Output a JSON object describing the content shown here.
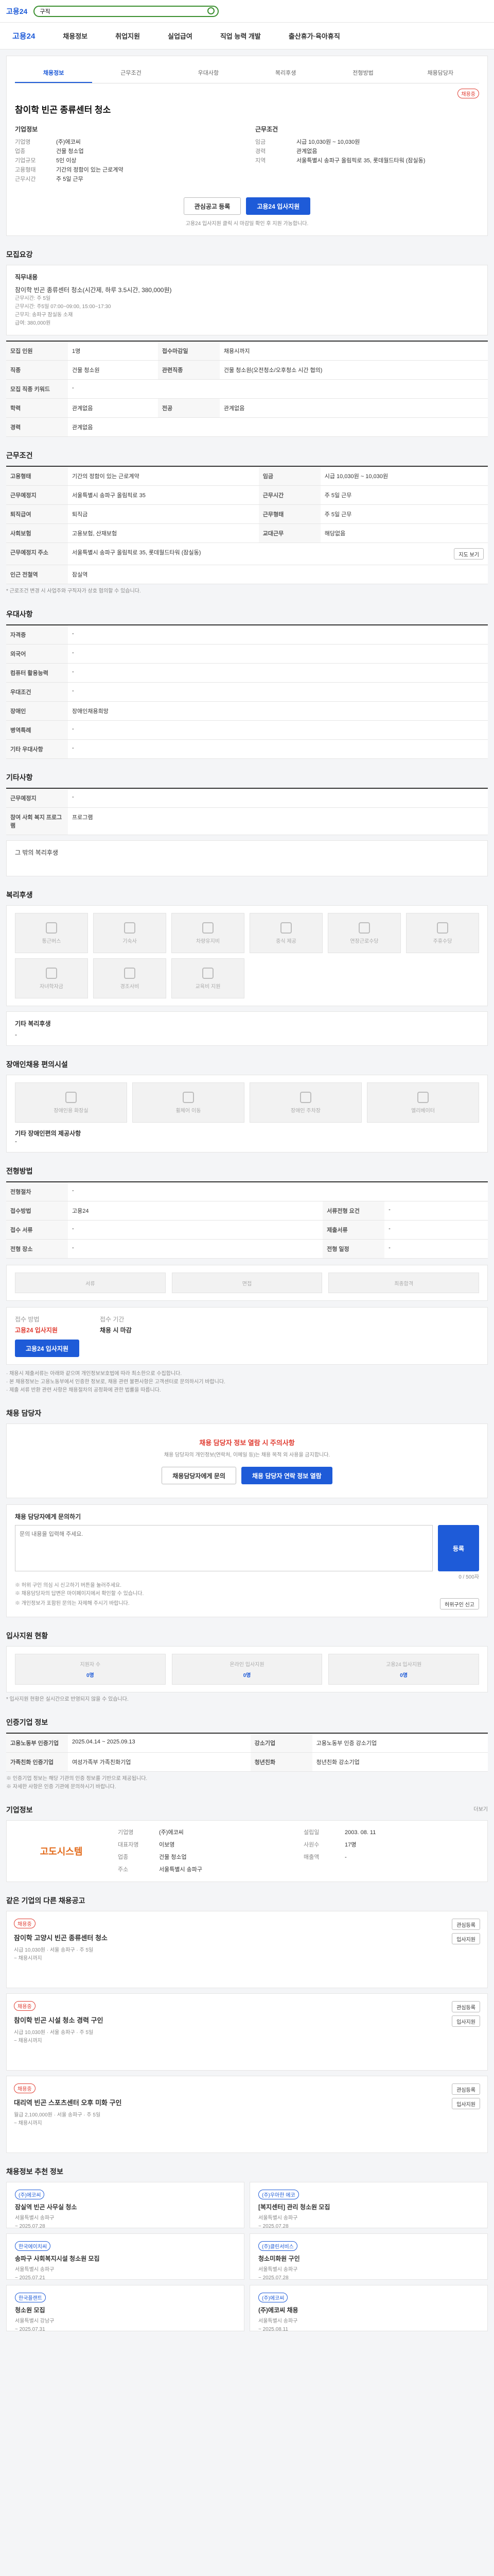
{
  "header": {
    "logo": "고용24",
    "search_value": "구직",
    "gnb": [
      "채용정보",
      "취업지원",
      "실업급여",
      "직업 능력 개발",
      "출산휴가·육아휴직"
    ]
  },
  "breadcrumb_tabs": [
    "채용정보",
    "근무조건",
    "우대사항",
    "복리후생",
    "전형방법",
    "채용담당자"
  ],
  "job": {
    "status": "채용중",
    "title": "참이학 빈곤 종류센터 청소",
    "company_label": "기업정보",
    "company_rows": [
      {
        "k": "기업명",
        "v": "(주)에코씨"
      },
      {
        "k": "업종",
        "v": "건물 청소업"
      },
      {
        "k": "기업규모",
        "v": "5인 이상"
      },
      {
        "k": "고용형태",
        "v": "기간의 정함이 있는 근로계약"
      },
      {
        "k": "근무시간",
        "v": "주 5일 근무"
      }
    ],
    "work_label": "근무조건",
    "work_rows": [
      {
        "k": "임금",
        "v": "시급 10,030원 ~ 10,030원"
      },
      {
        "k": "경력",
        "v": "관계없음"
      },
      {
        "k": "지역",
        "v": "서울특별시 송파구 올림픽로 35, 롯데월드타워 (잠실동)"
      }
    ],
    "btn_scrap": "관심공고 등록",
    "btn_apply": "고용24 입사지원",
    "deadline_note": "고용24 입사지원 클릭 시 마감일 확인 후 지원 가능합니다."
  },
  "recruit": {
    "title": "모집요강",
    "duty_label": "직무내용",
    "duty_text": "참이학 빈곤 종류센터 청소(시간제, 하루 3.5시간, 380,000원)",
    "duty_lines": [
      "근무시간: 주 5일",
      "근무시간: 주5일 07:00~09:00, 15:00~17:30",
      "근무지: 송파구 잠실동 소재",
      "급여: 380,000원"
    ],
    "rows": [
      {
        "k": "모집 인원",
        "v": "1명",
        "k2": "접수마감일",
        "v2": "채용시까지"
      },
      {
        "k": "직종",
        "v": "건물 청소원",
        "k2": "관련직종",
        "v2": "건물 청소원(오전청소/오후청소 시간 협의)"
      },
      {
        "k": "모집 직종 키워드",
        "v": "-",
        "k2": "",
        "v2": ""
      },
      {
        "k": "학력",
        "v": "관계없음",
        "k2": "전공",
        "v2": "관계없음"
      },
      {
        "k": "경력",
        "v": "관계없음",
        "k2": "",
        "v2": ""
      }
    ]
  },
  "condition": {
    "title": "근무조건",
    "rows": [
      {
        "k": "고용형태",
        "v": "기간의 정함이 있는 근로계약",
        "k2": "임금",
        "v2": "시급 10,030원 ~ 10,030원"
      },
      {
        "k": "근무예정지",
        "v": "서울특별시 송파구 올림픽로 35",
        "k2": "근무시간",
        "v2": "주 5일 근무"
      },
      {
        "k": "퇴직급여",
        "v": "퇴직금",
        "k2": "근무형태",
        "v2": "주 5일 근무"
      },
      {
        "k": "사회보험",
        "v": "고용보험, 산재보험",
        "k2": "교대근무",
        "v2": "해당없음"
      },
      {
        "k": "근무예정지 주소",
        "v": "서울특별시 송파구 올림픽로 35, 롯데월드타워 (잠실동)",
        "k2": "",
        "v2": ""
      },
      {
        "k": "인근 전철역",
        "v": "잠실역",
        "k2": "",
        "v2": ""
      }
    ],
    "map_btn": "지도 보기",
    "footnote": "* 근로조건 변경 시 사업주와 구직자가 상호 협의할 수 있습니다."
  },
  "preference": {
    "title": "우대사항",
    "rows": [
      {
        "k": "자격증",
        "v": "-"
      },
      {
        "k": "외국어",
        "v": "-"
      },
      {
        "k": "컴퓨터 활용능력",
        "v": "-"
      },
      {
        "k": "우대조건",
        "v": "-"
      },
      {
        "k": "장애인",
        "v": "장애인채용희망"
      },
      {
        "k": "병역특례",
        "v": "-"
      },
      {
        "k": "기타 우대사항",
        "v": "-"
      }
    ]
  },
  "etc_cond": {
    "title": "기타사항",
    "rows": [
      {
        "k": "근무예정지",
        "v": "-"
      },
      {
        "k": "참여 사회 복지 프로그램",
        "v": "프로그램"
      }
    ],
    "extra": "그 밖의 복리후생"
  },
  "welfare": {
    "title": "복리후생",
    "items": [
      "통근버스",
      "기숙사",
      "차량유지비",
      "중식 제공",
      "연장근로수당",
      "주휴수당",
      "자녀학자금",
      "경조사비",
      "교육비 지원"
    ],
    "etc_label": "기타 복리후생",
    "etc_value": "-"
  },
  "disability": {
    "title": "장애인채용 편의시설",
    "items": [
      "장애인용 화장실",
      "휠체어 이동",
      "장애인 주차장",
      "엘리베이터"
    ],
    "etc_label": "기타 장애인편의 제공사항",
    "etc_value": "-"
  },
  "process": {
    "title": "전형방법",
    "rows": [
      {
        "k": "전형절차",
        "v": "-"
      },
      {
        "k": "접수방법",
        "v": "고용24",
        "k2": "서류전형 요건",
        "v2": "-"
      },
      {
        "k": "접수 서류",
        "v": "-",
        "k2": "제출서류",
        "v2": "-"
      },
      {
        "k": "전형 장소",
        "v": "-",
        "k2": "전형 일정",
        "v2": "-"
      }
    ],
    "steps": [
      "서류",
      "면접",
      "최종합격"
    ],
    "notice_lines": [
      "· 채용시 제출서류는 아래와 같으며 개인정보보호법에 따라 최소한으로 수집합니다.",
      "· 본 채용정보는 고용노동부에서 인증한 정보로, 채용 관련 불편사항은 고객센터로 문의하시기 바랍니다.",
      "· 제출 서류 반환 관련 사항은 채용절차의 공정화에 관한 법률을 따릅니다."
    ],
    "apply_box_k": "접수 방법",
    "apply_box_v": "고용24 입사지원",
    "apply_box_k2": "접수 기간",
    "apply_box_v2": "채용 시 마감",
    "apply_btn": "고용24 입사지원"
  },
  "contact": {
    "title": "채용 담당자",
    "alert_title": "채용 담당자 정보 열람 시 주의사항",
    "alert_text": "채용 담당자의 개인정보(연락처, 이메일 등)는 채용 목적 외 사용을 금지합니다.",
    "btn_1": "채용담당자에게 문의",
    "btn_2": "채용 담당자 연락 정보 열람",
    "inquiry_label": "채용 담당자에게 문의하기",
    "inquiry_placeholder": "문의 내용을 입력해 주세요.",
    "inquiry_count": "0 / 500자",
    "inquiry_btn": "등록",
    "notes": [
      "※ 허위 구인 의심 시 신고하기 버튼을 눌러주세요.",
      "※ 채용담당자의 답변은 마이페이지에서 확인할 수 있습니다.",
      "※ 개인정보가 포함된 문의는 자제해 주시기 바랍니다."
    ],
    "report_btn": "허위구인 신고"
  },
  "apply_status": {
    "title": "입사지원 현황",
    "items": [
      {
        "label": "지원자 수",
        "value": "0명"
      },
      {
        "label": "온라인 입사지원",
        "value": "0명"
      },
      {
        "label": "고용24 입사지원",
        "value": "0명"
      }
    ],
    "note": "* 입사지원 현황은 실시간으로 반영되지 않을 수 있습니다."
  },
  "enterprise": {
    "title": "인증기업 정보",
    "rows": [
      {
        "k": "고용노동부 인증기업",
        "v": "2025.04.14 ~ 2025.09.13",
        "k2": "강소기업",
        "v2": "고용노동부 인증 강소기업"
      },
      {
        "k": "가족친화 인증기업",
        "v": "여성가족부 가족친화기업",
        "k2": "청년친화",
        "v2": "청년친화 강소기업"
      }
    ],
    "notes": [
      "※ 인증기업 정보는 해당 기관의 인증 정보를 기반으로 제공됩니다.",
      "※ 자세한 사항은 인증 기관에 문의하시기 바랍니다."
    ]
  },
  "company": {
    "title": "기업정보",
    "more": "더보기",
    "logo_text": "고도시스템",
    "rows": [
      {
        "k": "기업명",
        "v": "(주)에코씨",
        "k2": "설립일",
        "v2": "2003. 08. 11"
      },
      {
        "k": "대표자명",
        "v": "이보영",
        "k2": "사원수",
        "v2": "17명"
      },
      {
        "k": "업종",
        "v": "건물 청소업",
        "k2": "매출액",
        "v2": "-"
      },
      {
        "k": "주소",
        "v": "서울특별시 송파구",
        "k2": "",
        "v2": ""
      }
    ]
  },
  "other_jobs": {
    "title": "같은 기업의 다른 채용공고",
    "items": [
      {
        "badge": "채용중",
        "title": "잠이학 고양시 빈곤 종류센터 청소",
        "sub": "시급 10,030원 · 서울 송파구 · 주 5일",
        "date": "~ 채용시까지"
      },
      {
        "badge": "채용중",
        "title": "참이학 빈곤 시설 청소 경력 구인",
        "sub": "시급 10,030원 · 서울 송파구 · 주 5일",
        "date": "~ 채용시까지"
      },
      {
        "badge": "채용중",
        "title": "대리역 빈곤 스포츠센터 오후 미화 구인",
        "sub": "월급 2,100,000원 · 서울 송파구 · 주 5일",
        "date": "~ 채용시까지"
      }
    ],
    "btn_scrap": "관심등록",
    "btn_apply": "입사지원"
  },
  "recommend": {
    "title": "채용정보 추천 정보",
    "items": [
      {
        "company": "(주)에코씨",
        "title": "잠실역 빈곤 사무실 청소",
        "loc": "서울특별시 송파구",
        "date": "~ 2025.07.28"
      },
      {
        "company": "(주)우아한 에코",
        "title": "[복지센터] 관리 청소원 모집",
        "loc": "서울특별시 송파구",
        "date": "~ 2025.07.28"
      },
      {
        "company": "한국에이치씨",
        "title": "송파구 사회복지시설 청소원 모집",
        "loc": "서울특별시 송파구",
        "date": "~ 2025.07.21"
      },
      {
        "company": "(주)클린서비스",
        "title": "청소미화원 구인",
        "loc": "서울특별시 송파구",
        "date": "~ 2025.07.28"
      },
      {
        "company": "한국플랜트",
        "title": "청소원 모집",
        "loc": "서울특별시 강남구",
        "date": "~ 2025.07.31"
      },
      {
        "company": "(주)에코씨",
        "title": "(주)에코씨 채용",
        "loc": "서울특별시 송파구",
        "date": "~ 2025.08.11"
      }
    ]
  }
}
